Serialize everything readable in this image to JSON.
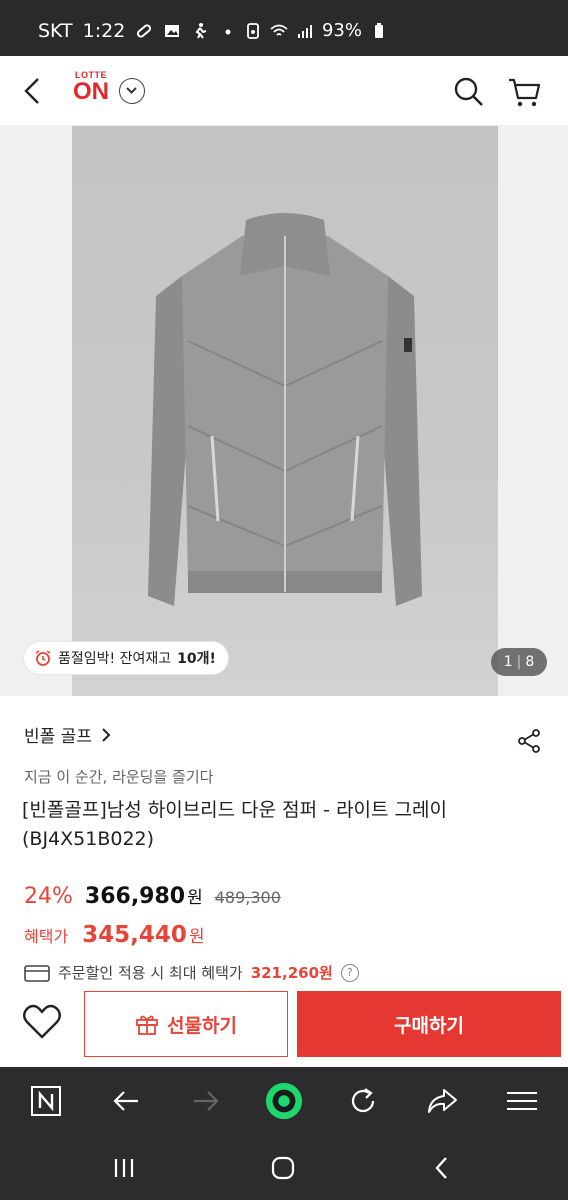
{
  "status_bar": {
    "carrier": "SKT",
    "time": "1:22",
    "battery": "93%"
  },
  "header": {
    "logo_top": "LOTTE",
    "logo_main": "ON"
  },
  "gallery": {
    "stock_text": "품절임박! 잔여재고 ",
    "stock_count": "10개!",
    "page_current": "1",
    "page_total": "8"
  },
  "product": {
    "brand": "빈폴 골프",
    "tagline": "지금 이 순간, 라운딩을 즐기다",
    "title_line1": "[빈폴골프]남성 하이브리드 다운 점퍼 - 라이트 그레이",
    "title_line2": "(BJ4X51B022)",
    "discount_rate": "24%",
    "sale_price": "366,980",
    "currency": "원",
    "original_price": "489,300",
    "benefit_label": "혜택가",
    "benefit_price": "345,440",
    "coupon_text": "주문할인 적용 시 최대 혜택가",
    "coupon_price": "321,260원",
    "help_glyph": "?"
  },
  "actions": {
    "gift_label": "선물하기",
    "buy_label": "구매하기"
  },
  "colors": {
    "brand_red": "#e6252a",
    "accent_red": "#e6453a",
    "buy_bg": "#e63832",
    "toolbar_bg": "#2c2c2e"
  }
}
